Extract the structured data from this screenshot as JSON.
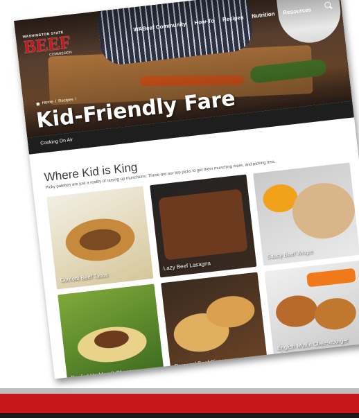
{
  "site": {
    "logo_state": "WASHINGTON STATE",
    "logo_name": "BEEF",
    "logo_commission": "COMMISSION"
  },
  "nav": {
    "items": [
      "WABeef Community",
      "How-To",
      "Recipes",
      "Nutrition",
      "Resources"
    ]
  },
  "breadcrumb": {
    "home": "Home",
    "sep1": "/",
    "recipes": "Recipes",
    "sep2": "/"
  },
  "hero": {
    "title": "Kid-Friendly Fare"
  },
  "subnav": {
    "link": "Cooking On Air"
  },
  "section": {
    "title": "Where Kid is King",
    "description": "Picky palettes are just a reality of raising up munchkins. These are our top picks to get them munching more, and picking less."
  },
  "recipes": [
    {
      "label": "Confetti Beef Tacos"
    },
    {
      "label": "Lazy Beef Lasagna"
    },
    {
      "label": "Saucy Beef Wraps"
    },
    {
      "label": "Beefed Up Mac & Cheese"
    },
    {
      "label": "Personal Beef Pizzas"
    },
    {
      "label": "English Muffin Cheeseburger Pizzas"
    }
  ],
  "colors": {
    "brand_red": "#c8161d",
    "subnav": "#1e1e1e"
  }
}
